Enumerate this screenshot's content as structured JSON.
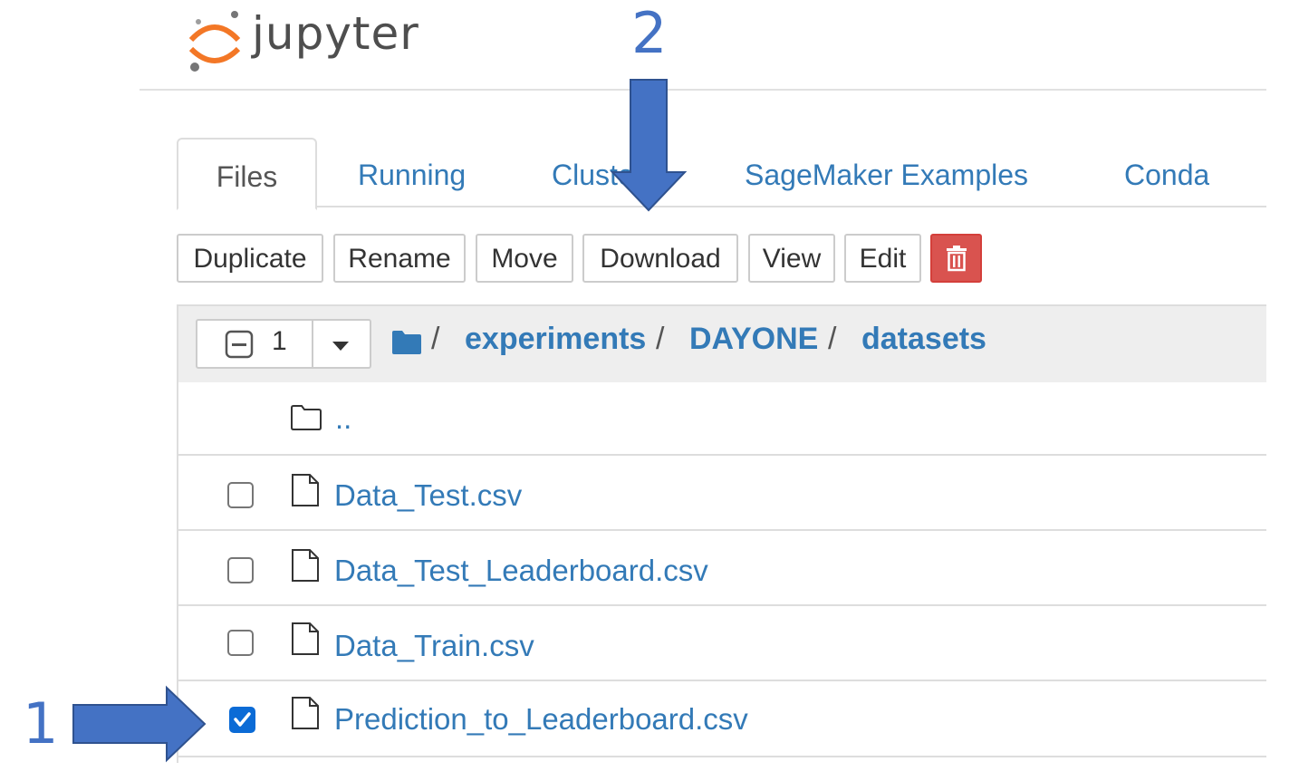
{
  "header": {
    "logo_text": "jupyter"
  },
  "tabs": [
    {
      "label": "Files",
      "active": true
    },
    {
      "label": "Running",
      "active": false
    },
    {
      "label": "Clusters",
      "active": false
    },
    {
      "label": "SageMaker Examples",
      "active": false
    },
    {
      "label": "Conda",
      "active": false
    }
  ],
  "toolbar": {
    "duplicate": "Duplicate",
    "rename": "Rename",
    "move": "Move",
    "download": "Download",
    "view": "View",
    "edit": "Edit",
    "delete_icon": "trash-icon"
  },
  "selection": {
    "count": "1"
  },
  "breadcrumb": {
    "separator": "/",
    "items": [
      "experiments",
      "DAYONE",
      "datasets"
    ]
  },
  "files": {
    "parent": "..",
    "items": [
      {
        "name": "Data_Test.csv",
        "checked": false
      },
      {
        "name": "Data_Test_Leaderboard.csv",
        "checked": false
      },
      {
        "name": "Data_Train.csv",
        "checked": false
      },
      {
        "name": "Prediction_to_Leaderboard.csv",
        "checked": true
      }
    ]
  },
  "annotations": {
    "step1": "1",
    "step2": "2",
    "arrow_color": "#4472c4"
  },
  "colors": {
    "link": "#337ab7",
    "danger": "#d9534f",
    "logo_orange": "#f37726"
  }
}
